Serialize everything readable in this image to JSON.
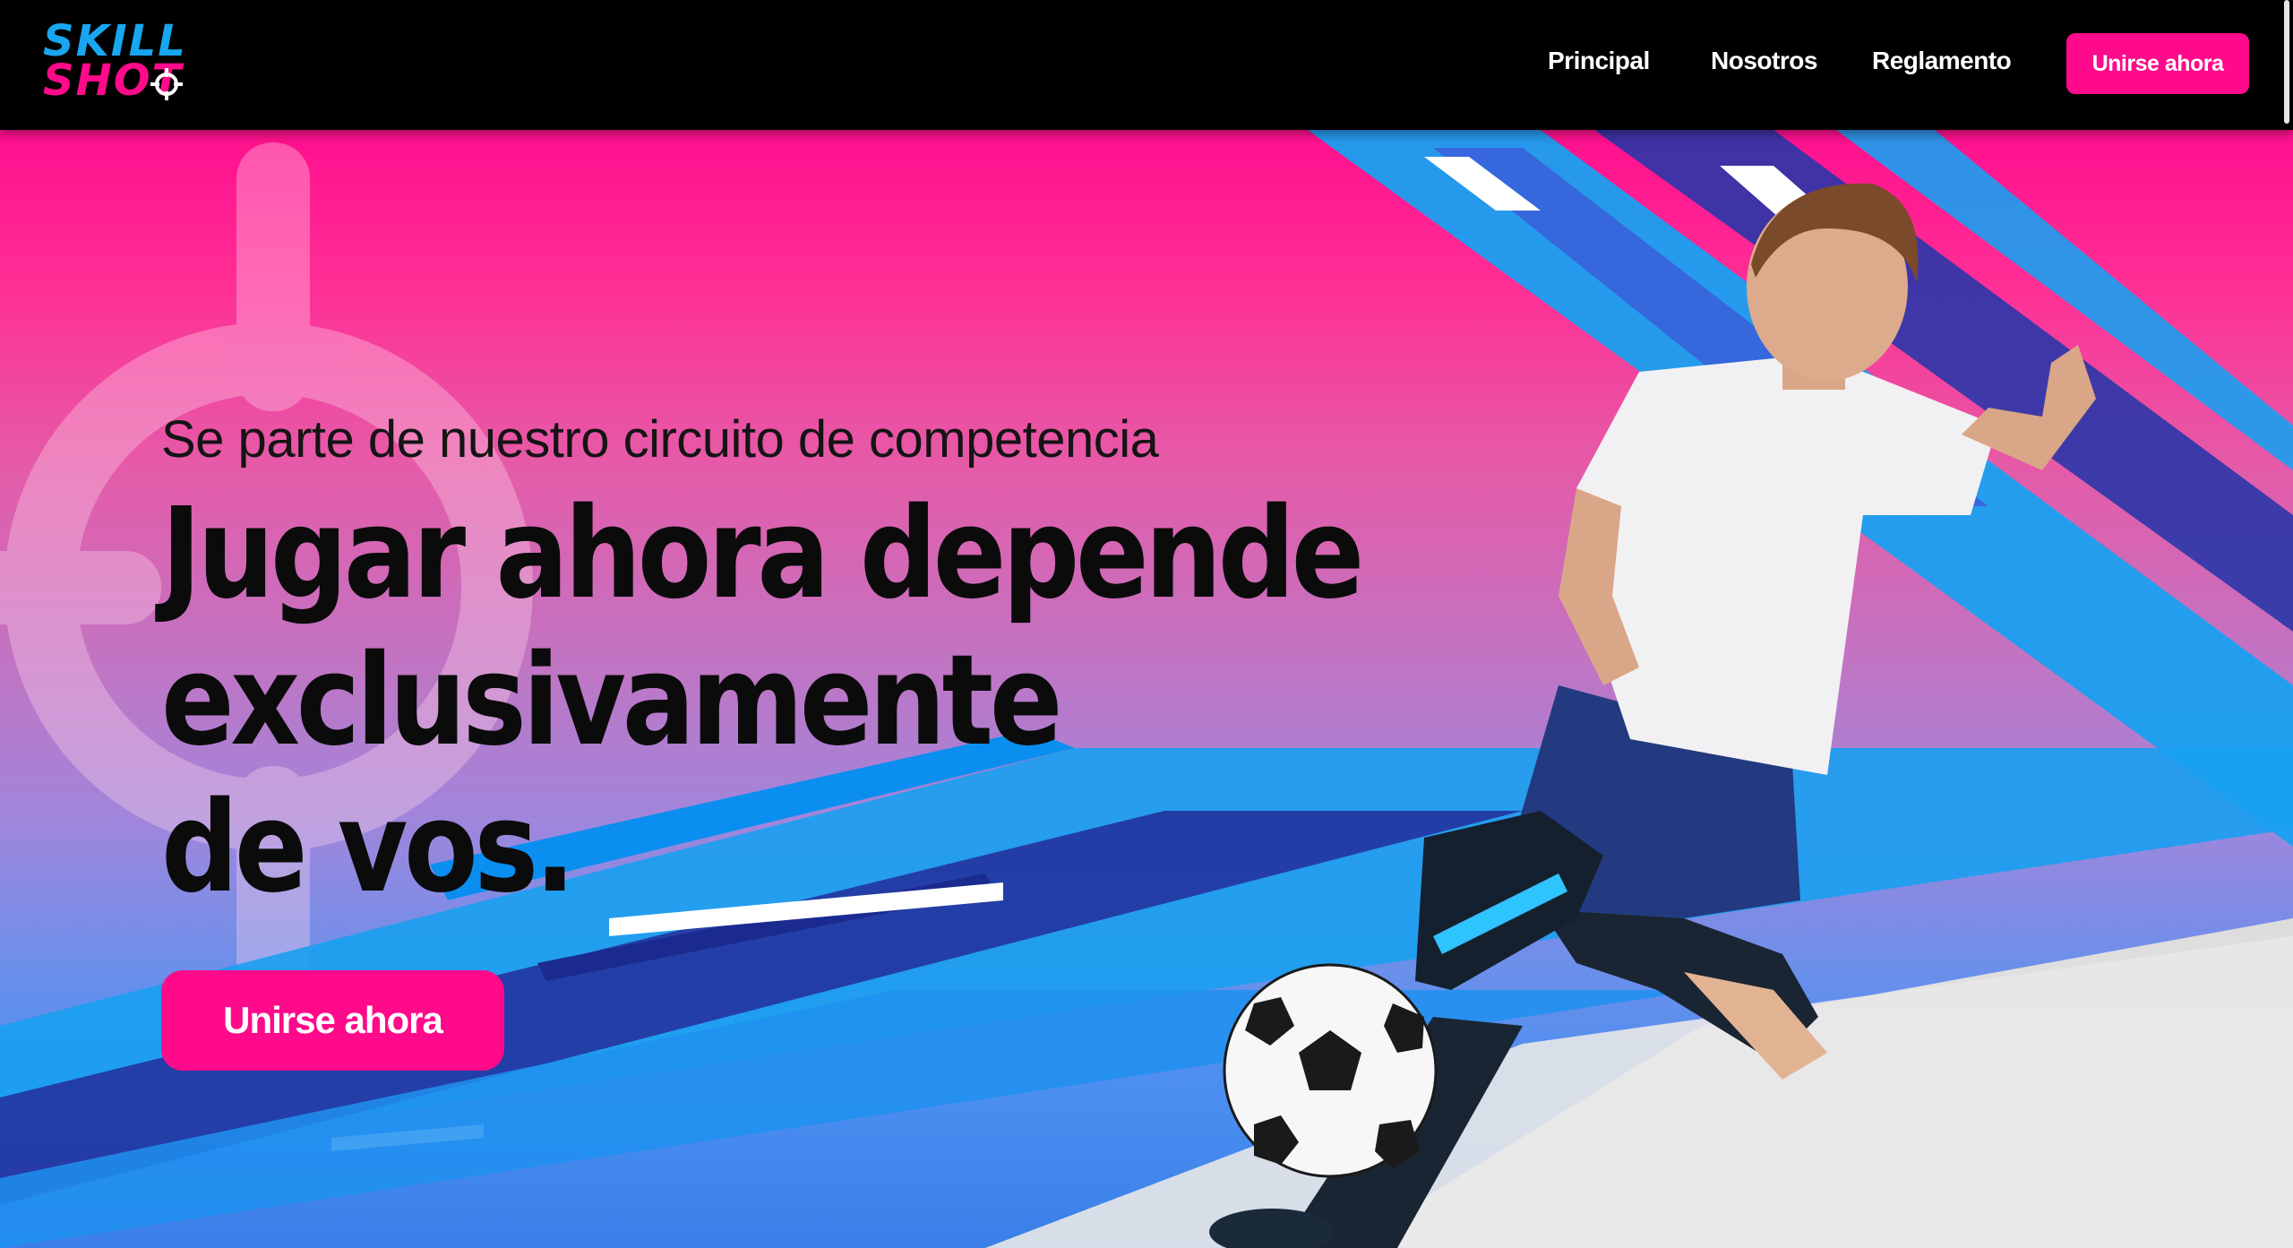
{
  "header": {
    "logo": {
      "line1": "SKILL",
      "line2": "SHOT"
    },
    "nav": [
      {
        "label": "Principal"
      },
      {
        "label": "Nosotros"
      },
      {
        "label": "Reglamento"
      }
    ],
    "cta_label": "Unirse ahora"
  },
  "hero": {
    "subtitle": "Se parte de nuestro circuito de competencia",
    "headline": {
      "line1": "Jugar ahora depende",
      "line2": "exclusivamente",
      "line3": "de vos."
    },
    "cta_label": "Unirse ahora"
  },
  "colors": {
    "accent": "#ff0a8a",
    "logo_blue": "#19a6f0",
    "header_bg": "#000000",
    "stripe_blue": "#1aa0f0",
    "stripe_navy": "#1f2f9a"
  },
  "icons": {
    "logo_target": "crosshair-icon",
    "hero_target": "crosshair-icon"
  }
}
